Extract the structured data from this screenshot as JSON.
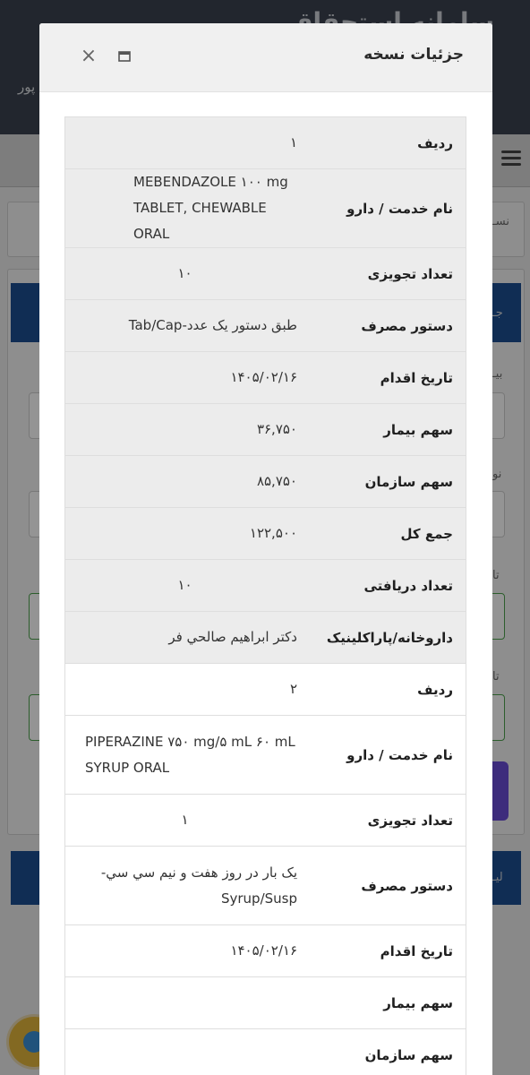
{
  "background": {
    "header_text": "سامانه استحقاق",
    "header_sub": "پور",
    "side_labels": [
      "نسـ",
      "جـ",
      "بيـ",
      "نو",
      "تا",
      "تا",
      "لیـ"
    ]
  },
  "modal": {
    "title": "جزئیات نسخه",
    "close_icon": "close-icon",
    "maximize_icon": "maximize-icon",
    "rows": [
      {
        "label": "ردیف",
        "value": "۱"
      },
      {
        "label": "نام خدمت / دارو",
        "value": "MEBENDAZOLE ۱۰۰ mg TABLET, CHEWABLE ORAL"
      },
      {
        "label": "تعداد تجویزی",
        "value": "۱۰"
      },
      {
        "label": "دستور مصرف",
        "value": "طبق دستور یک عدد-Tab/Cap"
      },
      {
        "label": "تاریخ اقدام",
        "value": "۱۴۰۵/۰۲/۱۶"
      },
      {
        "label": "سهم بیمار",
        "value": "۳۶,۷۵۰"
      },
      {
        "label": "سهم سازمان",
        "value": "۸۵,۷۵۰"
      },
      {
        "label": "جمع کل",
        "value": "۱۲۲,۵۰۰"
      },
      {
        "label": "تعداد دریافتی",
        "value": "۱۰"
      },
      {
        "label": "داروخانه/پاراکلینیک",
        "value": "دکتر ابراهیم صالحي فر"
      },
      {
        "label": "ردیف",
        "value": "۲"
      },
      {
        "label": "نام خدمت / دارو",
        "value": "PIPERAZINE ۷۵۰ mg/۵ mL ۶۰ mL SYRUP ORAL"
      },
      {
        "label": "تعداد تجویزی",
        "value": "۱"
      },
      {
        "label": "دستور مصرف",
        "value": "یک بار در روز هفت و نیم سي سي-Syrup/Susp"
      },
      {
        "label": "تاریخ اقدام",
        "value": "۱۴۰۵/۰۲/۱۶"
      },
      {
        "label": "سهم بیمار",
        "value": ""
      },
      {
        "label": "سهم سازمان",
        "value": ""
      }
    ]
  }
}
